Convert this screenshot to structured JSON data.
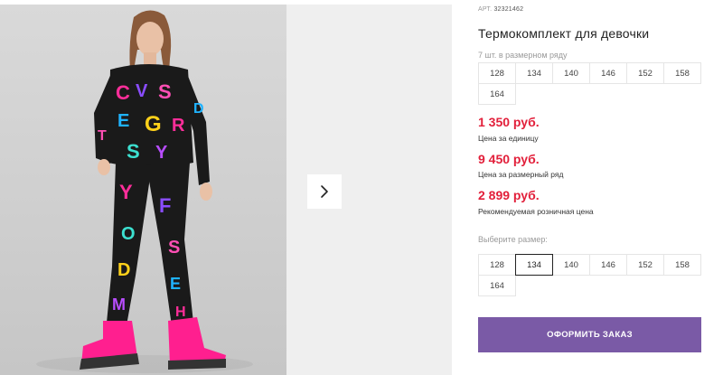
{
  "product": {
    "sku_label": "АРТ.",
    "sku_value": "32321462",
    "title": "Термокомплект для девочки"
  },
  "assortment": {
    "caption": "7 шт. в размерном ряду",
    "sizes": [
      "128",
      "134",
      "140",
      "146",
      "152",
      "158",
      "164"
    ]
  },
  "prices": {
    "unit_price": "1 350 руб.",
    "unit_note": "Цена за единицу",
    "row_price": "9 450 руб.",
    "row_note": "Цена за размерный ряд",
    "retail_price": "2 899 руб.",
    "retail_note": "Рекомендуемая розничная цена"
  },
  "size_picker": {
    "caption": "Выберите размер:",
    "sizes": [
      "128",
      "134",
      "140",
      "146",
      "152",
      "158",
      "164"
    ],
    "selected": "134"
  },
  "actions": {
    "order_label": "ОФОРМИТЬ ЗАКАЗ"
  },
  "icons": {
    "next": "chevron-right-icon"
  },
  "colors": {
    "price": "#e21f3a",
    "order_button": "#7a5aa6",
    "selected_border": "#222222"
  }
}
